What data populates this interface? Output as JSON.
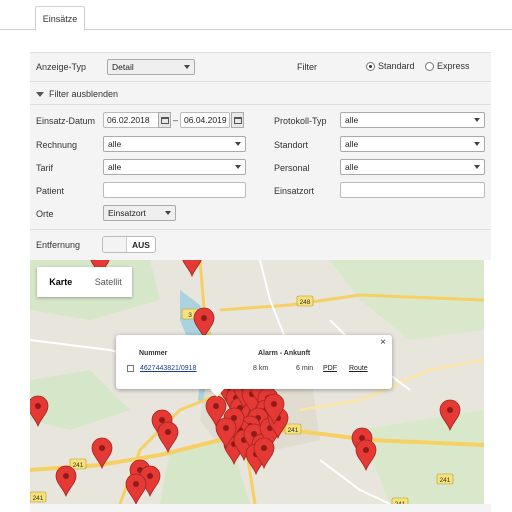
{
  "tab": {
    "label": "Einsätze"
  },
  "form": {
    "anzeige_typ": {
      "label": "Anzeige-Typ",
      "value": "Detail"
    },
    "filter": {
      "label": "Filter",
      "options": [
        "Standard",
        "Express"
      ],
      "selected": "Standard"
    },
    "filter_toggle_label": "Filter ausblenden",
    "einsatz_datum": {
      "label": "Einsatz-Datum",
      "from": "06.02.2018",
      "separator": "–",
      "to": "06.04.2019"
    },
    "protokoll_typ": {
      "label": "Protokoll-Typ",
      "value": "alle"
    },
    "rechnung": {
      "label": "Rechnung",
      "value": "alle"
    },
    "standort": {
      "label": "Standort",
      "value": "alle"
    },
    "tarif": {
      "label": "Tarif",
      "value": "alle"
    },
    "personal": {
      "label": "Personal",
      "value": "alle"
    },
    "patient": {
      "label": "Patient",
      "value": ""
    },
    "einsatzort": {
      "label": "Einsatzort",
      "value": ""
    },
    "orte": {
      "label": "Orte",
      "value": "Einsatzort"
    },
    "entfernung": {
      "label": "Entfernung",
      "toggle_value": "AUS"
    }
  },
  "map": {
    "tabs": [
      "Karte",
      "Satellit"
    ],
    "active_tab": "Karte",
    "road_labels": [
      "3",
      "248",
      "241",
      "241",
      "241",
      "241",
      "241"
    ],
    "pin_color": "#e53935",
    "popup": {
      "close": "×",
      "headers": {
        "nummer": "Nummer",
        "alarm": "Alarm - Ankunft"
      },
      "row": {
        "nummer": "4627443821/0918",
        "distance": "8 km",
        "duration": "6 min",
        "pdf": "PDF",
        "route": "Route"
      }
    }
  }
}
